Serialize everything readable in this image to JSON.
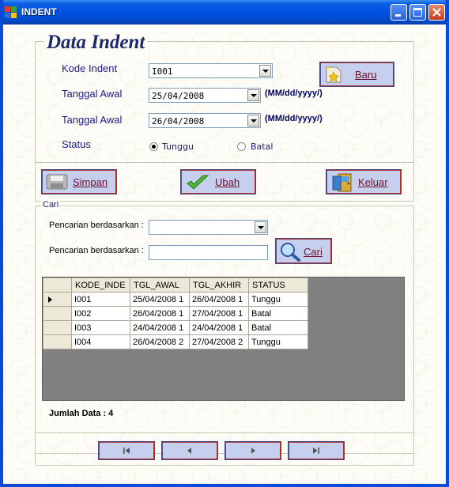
{
  "window": {
    "title": "INDENT"
  },
  "form": {
    "heading": "Data Indent",
    "kode_label": "Kode Indent",
    "kode_value": "I001",
    "tgl_awal_label": "Tanggal Awal",
    "tgl_awal_value": "25/04/2008",
    "tgl_akhir_label": "Tanggal Awal",
    "tgl_akhir_value": "26/04/2008",
    "date_format": "(MM/dd/yyyy/)",
    "date_format2": "(MM/dd/yyyy/)",
    "status_label": "Status",
    "status_options": [
      "Tunggu",
      "Batal"
    ],
    "status_selected": "Tunggu",
    "baru_label": "Baru"
  },
  "actions": {
    "simpan": "Simpan",
    "ubah": "Ubah",
    "keluar": "Keluar"
  },
  "search": {
    "group_title": "Cari",
    "label1": "Pencarian berdasarkan :",
    "label2": "Pencarian berdasarkan :",
    "combo_value": "",
    "text_value": "",
    "button": "Cari"
  },
  "table": {
    "columns": [
      "KODE_INDE",
      "TGL_AWAL",
      "TGL_AKHIR",
      "STATUS"
    ],
    "rows": [
      [
        "I001",
        "25/04/2008 1",
        "26/04/2008 1",
        "Tunggu"
      ],
      [
        "I002",
        "26/04/2008 1",
        "27/04/2008 1",
        "Batal"
      ],
      [
        "I003",
        "24/04/2008 1",
        "24/04/2008 1",
        "Batal"
      ],
      [
        "I004",
        "26/04/2008 2",
        "27/04/2008 2",
        "Tunggu"
      ]
    ],
    "current_row": 0
  },
  "footer": {
    "jumlah": "Jumlah Data : 4"
  },
  "nav": {
    "first": "first-icon",
    "prev": "prev-icon",
    "next": "next-icon",
    "last": "last-icon"
  }
}
